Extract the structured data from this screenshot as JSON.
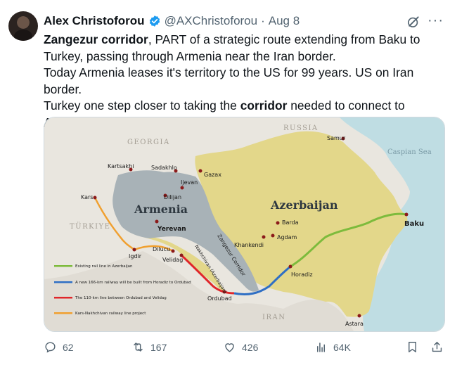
{
  "author": {
    "name": "Alex Christoforou",
    "handle": "@AXChristoforou",
    "separator": "·",
    "date": "Aug 8"
  },
  "tweet": {
    "part1_bold": "Zangezur corridor",
    "part1_rest": ", PART of a strategic route extending from Baku to Turkey, passing through Armenia near the Iran border.",
    "part2": "Today Armenia leases it's territory to the US for 99 years. US on Iran border.",
    "part3_start": "Turkey one step closer to taking the ",
    "part3_bold": "corridor",
    "part3_end": " needed to connect to Azerbaijan."
  },
  "map": {
    "countries": {
      "russia": "RUSSIA",
      "georgia": "GEORGIA",
      "turkiye": "TÜRKIYE",
      "iran": "IRAN",
      "armenia": "Armenia",
      "azerbaijan": "Azerbaijan"
    },
    "sea": "Caspian Sea",
    "cities": {
      "samur": "Samur",
      "kartsakhi": "Kartsakhi",
      "sadakhlo": "Sadakhlo",
      "gazax": "Gazax",
      "ijevan": "Ijevan",
      "dilijan": "Dilijan",
      "kars": "Kars",
      "yerevan": "Yerevan",
      "baku": "Baku",
      "barda": "Barda",
      "agdam": "Agdam",
      "khankendi": "Khankendi",
      "igdir": "Igdir",
      "dilucu": "Dilucu",
      "velidag": "Velidag",
      "horadiz": "Horadiz",
      "ordubad": "Ordubad",
      "astara": "Astara"
    },
    "corridor_label": "Zangezur Corridor",
    "nakhchivan_label": "Nakhchivan (Azerbaijan)",
    "legend": [
      {
        "color": "#7dbb3c",
        "text": "Existing rail line in Azerbaijan"
      },
      {
        "color": "#2f6fc4",
        "text": "A new 166-km railway will be built from Horadiz to Ordubad"
      },
      {
        "color": "#e0262a",
        "text": "The 110-km line between Ordubad and Velidag"
      },
      {
        "color": "#f0a030",
        "text": "Kars-Nakhchivan railway line project"
      }
    ]
  },
  "stats": {
    "replies": "62",
    "reposts": "167",
    "likes": "426",
    "views": "64K"
  },
  "icons": [
    "verified-badge-icon",
    "grok-icon",
    "more-icon",
    "reply-icon",
    "repost-icon",
    "like-icon",
    "views-icon",
    "bookmark-icon",
    "share-icon"
  ]
}
